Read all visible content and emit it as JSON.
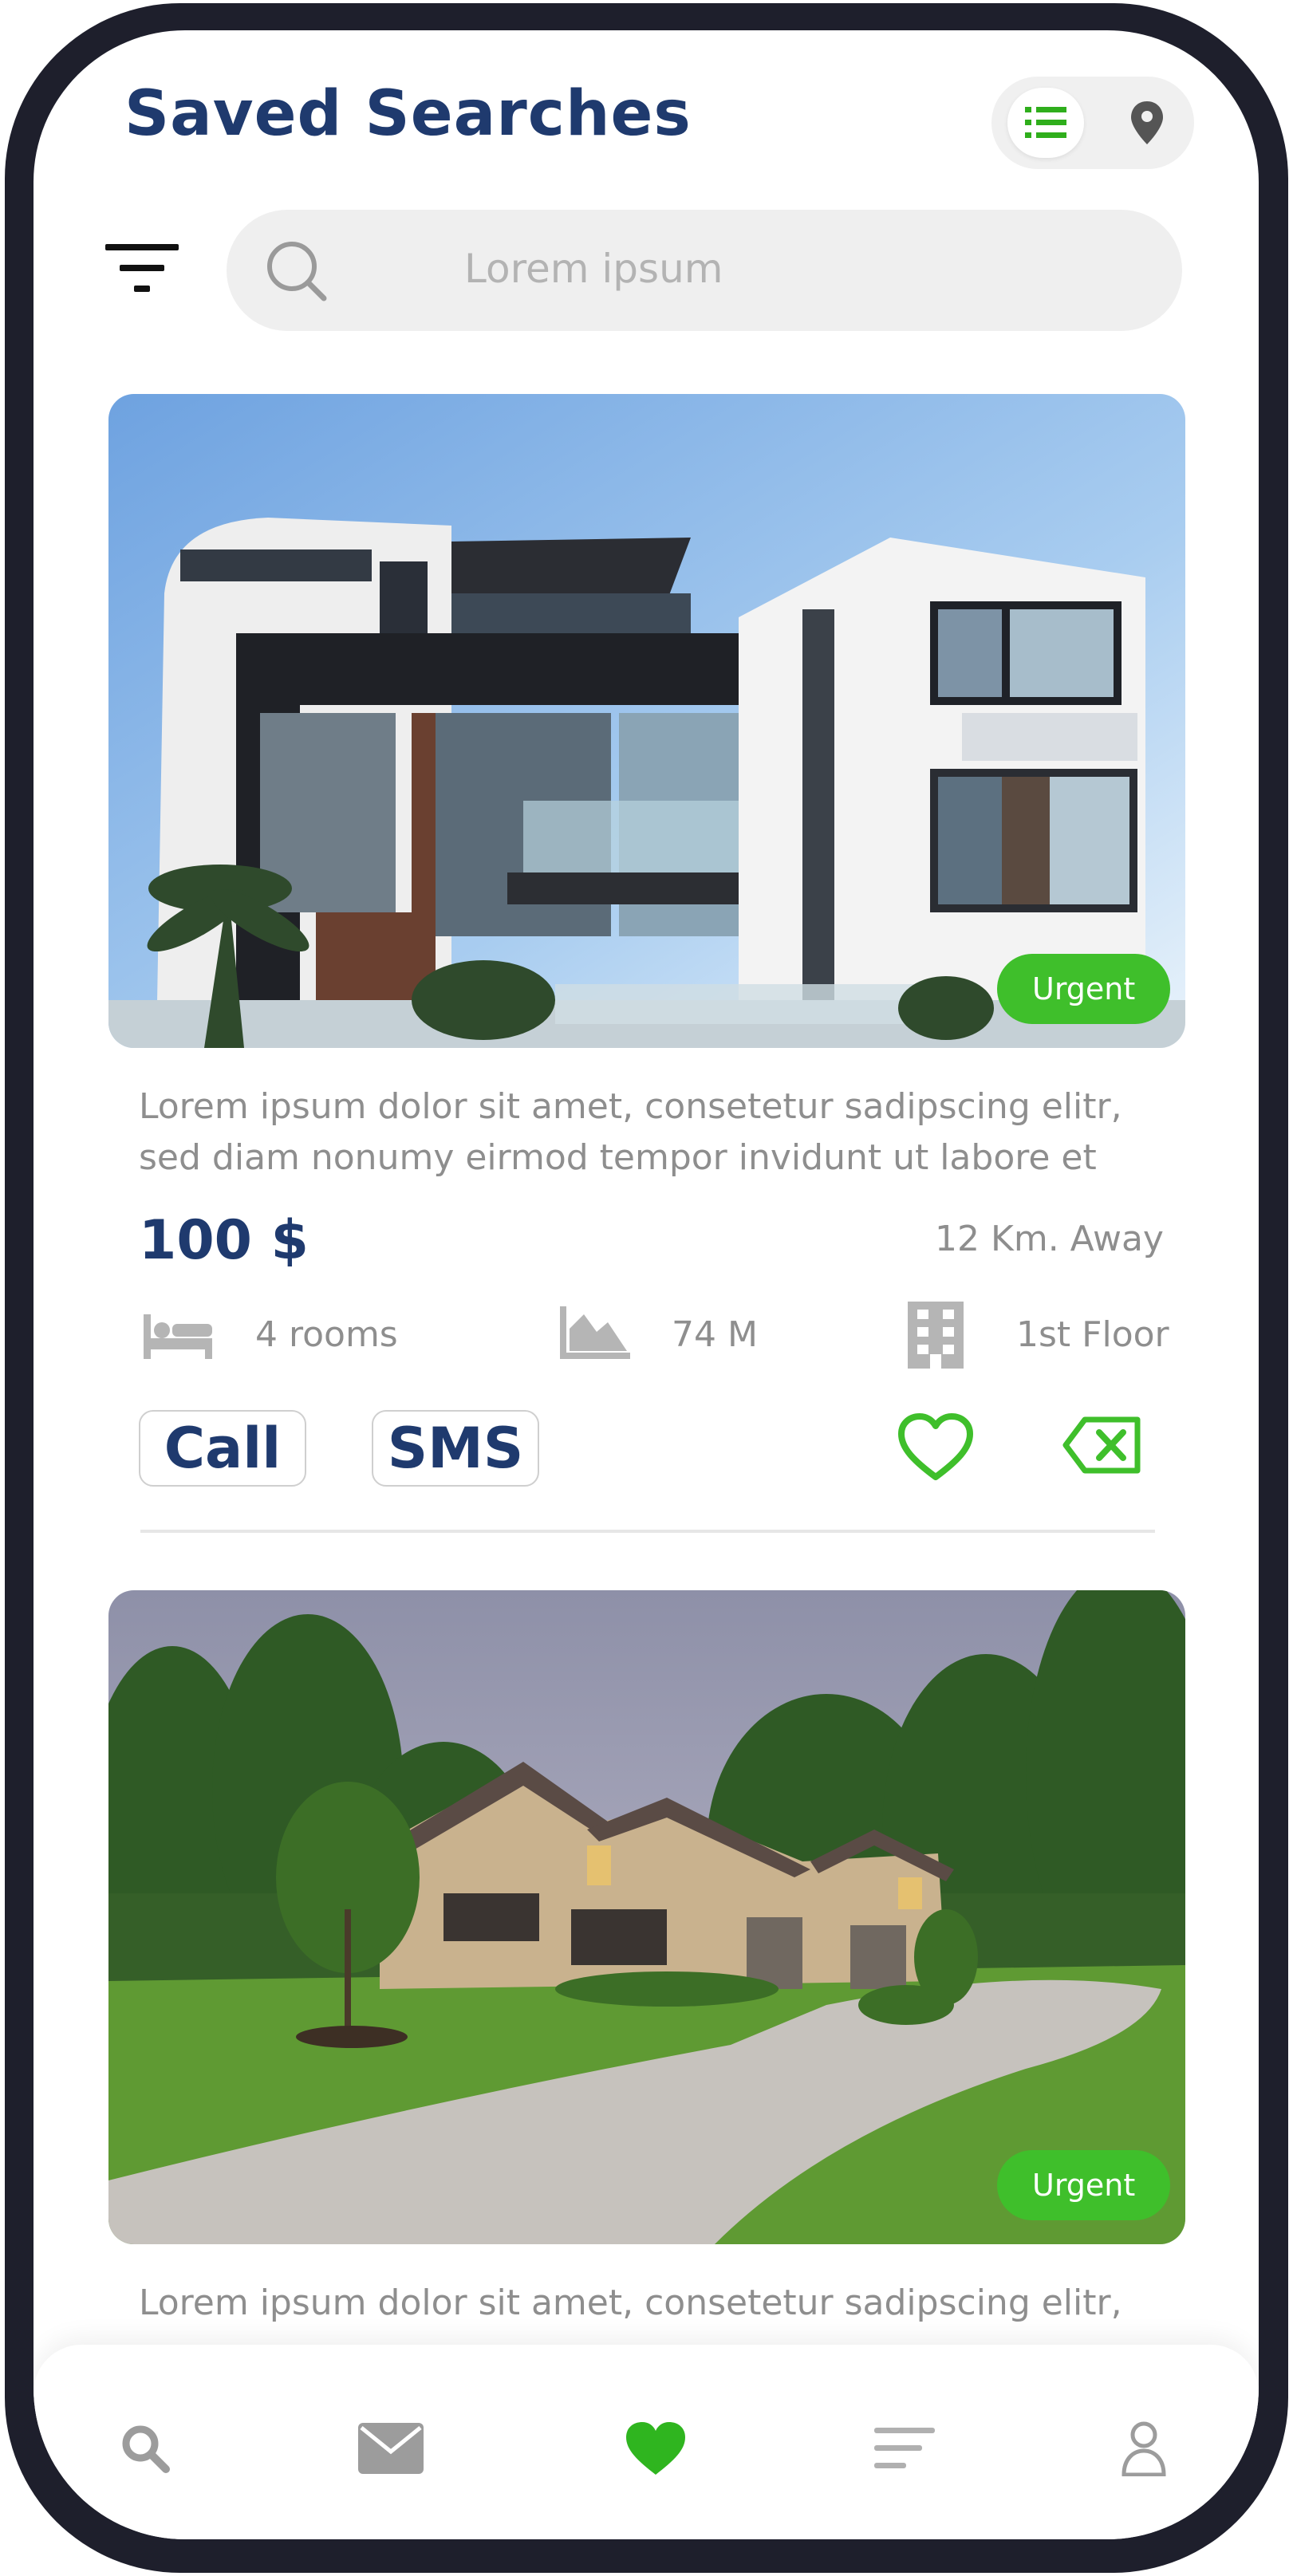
{
  "header": {
    "title": "Saved Searches"
  },
  "view_toggle": {
    "active": "list",
    "list_icon": "list-icon",
    "map_icon": "map-pin-icon"
  },
  "search": {
    "placeholder": "Lorem ipsum",
    "filter_icon": "filter-icon",
    "search_icon": "search-icon"
  },
  "colors": {
    "brand": "#1f3a6e",
    "accent": "#3fbf2b",
    "muted": "#8e8e8e"
  },
  "listings": [
    {
      "image_desc": "modern multi-storey white house with glass balconies",
      "badge": "Urgent",
      "description_line1": "Lorem ipsum dolor sit amet, consetetur sadipscing elitr,",
      "description_line2": "sed diam nonumy eirmod tempor invidunt ut labore et",
      "price": "100 $",
      "distance": "12 Km. Away",
      "rooms": "4 rooms",
      "area": "74 M",
      "floor": "1st Floor",
      "call_label": "Call",
      "sms_label": "SMS"
    },
    {
      "image_desc": "brick family house with lawn and curved driveway",
      "badge": "Urgent",
      "description_line1": "Lorem ipsum dolor sit amet, consetetur sadipscing elitr,"
    }
  ],
  "bottom_nav": {
    "items": [
      "search-icon",
      "mail-icon",
      "heart-icon",
      "menu-icon",
      "user-icon"
    ],
    "active": "heart-icon"
  }
}
